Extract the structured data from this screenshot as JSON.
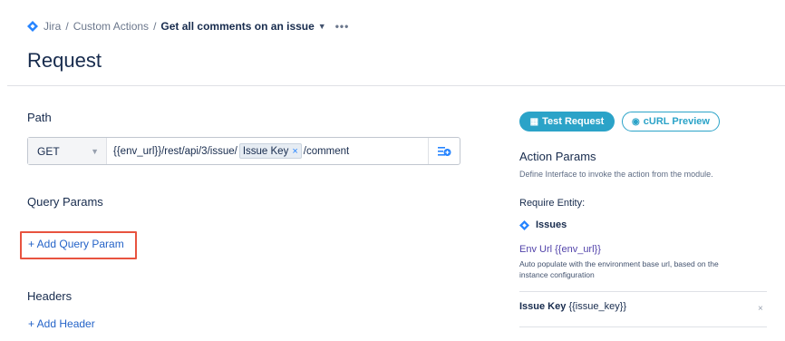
{
  "breadcrumb": {
    "items": [
      "Jira",
      "Custom Actions"
    ],
    "current": "Get all comments on an issue",
    "more": "•••"
  },
  "page": {
    "title": "Request"
  },
  "path": {
    "section_title": "Path",
    "method": "GET",
    "url_prefix": "{{env_url}}/rest/api/3/issue/",
    "token": "Issue Key",
    "token_remove": "×",
    "url_suffix": "/comment"
  },
  "query": {
    "section_title": "Query Params",
    "add_label": "+ Add Query Param"
  },
  "headers": {
    "section_title": "Headers",
    "add_label": "+ Add Header"
  },
  "actions": {
    "test_request": "Test Request",
    "curl_preview": "cURL Preview"
  },
  "action_params": {
    "title": "Action Params",
    "description": "Define Interface to invoke the action from the module.",
    "require_entity_label": "Require Entity:",
    "entity": "Issues",
    "env_url_label": "Env Url {{env_url}}",
    "env_url_desc": "Auto populate with the environment base url, based on the instance configuration",
    "issue_key_label": "Issue Key",
    "issue_key_var": "{{issue_key}}",
    "remove": "×"
  },
  "colors": {
    "accent": "#2ba3c8",
    "link": "#2463c8",
    "highlight": "#e8533f",
    "jira": "#2684ff"
  }
}
